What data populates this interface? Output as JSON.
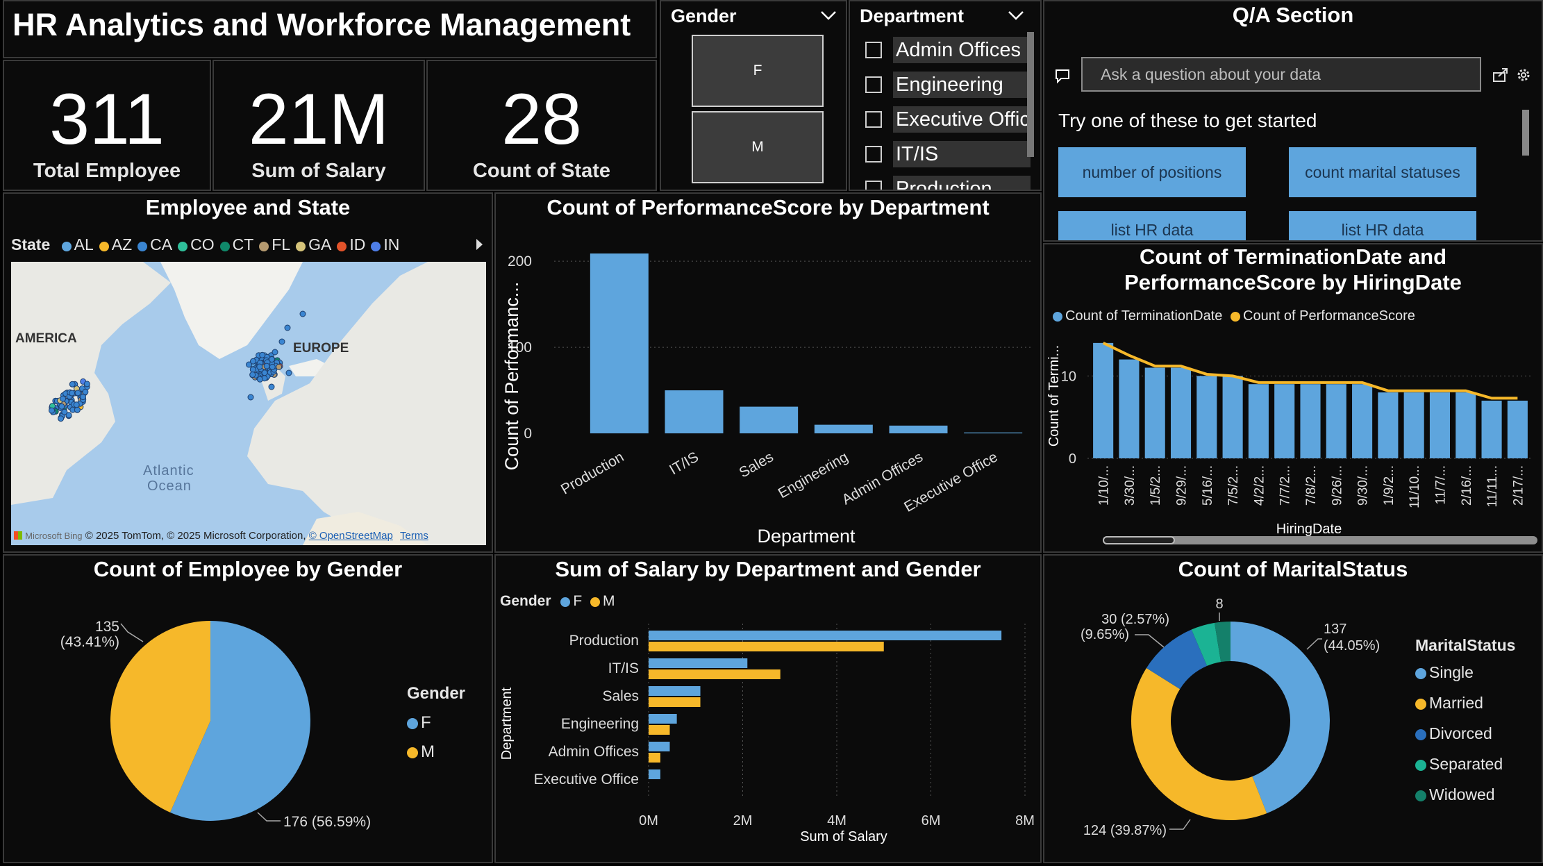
{
  "header": {
    "title": "HR Analytics and Workforce Management"
  },
  "kpis": [
    {
      "value": "311",
      "label": "Total Employee"
    },
    {
      "value": "21M",
      "label": "Sum of Salary"
    },
    {
      "value": "28",
      "label": "Count of State"
    }
  ],
  "gender_slicer": {
    "title": "Gender",
    "options": [
      "F",
      "M"
    ]
  },
  "department_slicer": {
    "title": "Department",
    "options": [
      "Admin Offices",
      "Engineering",
      "Executive Office",
      "IT/IS",
      "Production"
    ]
  },
  "qa": {
    "title": "Q/A Section",
    "placeholder": "Ask a question about your data",
    "prompt": "Try one of these to get started",
    "suggestions": [
      "number of positions",
      "count marital statuses",
      "list HR data",
      "list HR data"
    ]
  },
  "map": {
    "title": "Employee and State",
    "legend_title": "State",
    "states": [
      "AL",
      "AZ",
      "CA",
      "CO",
      "CT",
      "FL",
      "GA",
      "ID",
      "IN"
    ],
    "state_colors": [
      "#5ea5dd",
      "#f6b82a",
      "#3a85d1",
      "#2fbf9a",
      "#10886a",
      "#b59a70",
      "#d6c47a",
      "#e2532a",
      "#4e7ee8"
    ],
    "labels": {
      "america": "AMERICA",
      "europe": "EUROPE",
      "ocean1": "Atlantic",
      "ocean2": "Ocean"
    },
    "attribution": {
      "bing": "Microsoft Bing",
      "copyright": "© 2025 TomTom, © 2025 Microsoft Corporation,",
      "osm": "© OpenStreetMap",
      "terms": "Terms"
    }
  },
  "colors": {
    "blue": "#5ea5dd",
    "yellow": "#f6b82a",
    "darkblue": "#2a6fbd",
    "teal": "#1bb394",
    "darkteal": "#14806a"
  },
  "chart_data": [
    {
      "id": "perf_by_dept",
      "type": "bar",
      "title": "Count of PerformanceScore by Department",
      "categories": [
        "Production",
        "IT/IS",
        "Sales",
        "Engineering",
        "Admin Offices",
        "Executive Office"
      ],
      "values": [
        209,
        50,
        31,
        10,
        9,
        1
      ],
      "xlabel": "Department",
      "ylabel": "Count of Performanc...",
      "ylim": [
        0,
        230
      ],
      "yticks": [
        0,
        100,
        200
      ],
      "grid": true
    },
    {
      "id": "term_by_hiring",
      "type": "bar",
      "title": "Count of TerminationDate and PerformanceScore by HiringDate",
      "title_lines": [
        "Count of TerminationDate and",
        "PerformanceScore by HiringDate"
      ],
      "categories": [
        "1/10/...",
        "3/30/...",
        "1/5/2...",
        "9/29/...",
        "5/16/...",
        "7/5/2...",
        "4/2/2...",
        "7/7/2...",
        "7/8/2...",
        "9/26/...",
        "9/30/...",
        "1/9/2...",
        "11/10...",
        "11/7/...",
        "2/16/...",
        "11/11...",
        "2/17/..."
      ],
      "series": [
        {
          "name": "Count of TerminationDate",
          "type": "bar",
          "values": [
            14,
            12,
            11,
            11,
            10,
            10,
            9,
            9,
            9,
            9,
            9,
            8,
            8,
            8,
            8,
            7,
            7
          ]
        },
        {
          "name": "Count of PerformanceScore",
          "type": "line",
          "values": [
            14,
            12.5,
            11.2,
            11.2,
            10.2,
            10,
            9.2,
            9.2,
            9.2,
            9.2,
            9.2,
            8.2,
            8.2,
            8.2,
            8.2,
            7.3,
            7.3
          ]
        }
      ],
      "xlabel": "HiringDate",
      "ylabel": "Count of Termi...",
      "ylim": [
        0,
        15
      ],
      "yticks": [
        0,
        10
      ],
      "grid": true
    },
    {
      "id": "gender_pie",
      "type": "pie",
      "title": "Count of Employee by Gender",
      "legend_title": "Gender",
      "categories": [
        "F",
        "M"
      ],
      "values": [
        176,
        135
      ],
      "data_labels": [
        "176 (56.59%)",
        "135",
        "(43.41%)"
      ]
    },
    {
      "id": "salary_by_dept_gender",
      "type": "bar",
      "orientation": "horizontal",
      "title": "Sum of Salary by Department and Gender",
      "legend_title": "Gender",
      "categories": [
        "Production",
        "IT/IS",
        "Sales",
        "Engineering",
        "Admin Offices",
        "Executive Office"
      ],
      "series": [
        {
          "name": "F",
          "values": [
            7.5,
            2.1,
            1.1,
            0.6,
            0.45,
            0.25
          ]
        },
        {
          "name": "M",
          "values": [
            5.0,
            2.8,
            1.1,
            0.45,
            0.25,
            0
          ]
        }
      ],
      "xlabel": "Sum of Salary",
      "ylabel": "Department",
      "xlim": [
        0,
        8
      ],
      "xticks": [
        "0M",
        "2M",
        "4M",
        "6M",
        "8M"
      ],
      "grid": true
    },
    {
      "id": "marital_donut",
      "type": "pie",
      "title": "Count of MaritalStatus",
      "legend_title": "MaritalStatus",
      "categories": [
        "Single",
        "Married",
        "Divorced",
        "Separated",
        "Widowed"
      ],
      "values": [
        137,
        124,
        30,
        12,
        8
      ],
      "data_labels": [
        "137",
        "(44.05%)",
        "124 (39.87%)",
        "30 (2.57%)",
        "(9.65%)",
        "8"
      ]
    }
  ]
}
